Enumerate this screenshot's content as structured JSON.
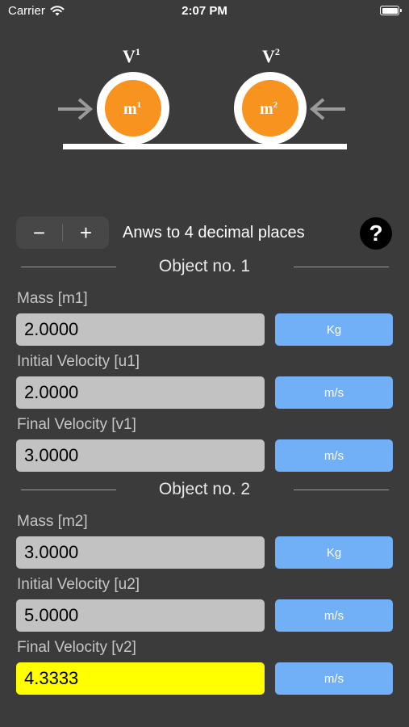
{
  "status_bar": {
    "carrier": "Carrier",
    "time": "2:07 PM"
  },
  "diagram": {
    "velocity_1": "V",
    "velocity_1_sup": "1",
    "velocity_2": "V",
    "velocity_2_sup": "2",
    "mass_1": "m",
    "mass_1_sup": "1",
    "mass_2": "m",
    "mass_2_sup": "2",
    "ball_color": "#f7931e"
  },
  "controls": {
    "minus_label": "−",
    "plus_label": "+",
    "decimals_label": "Anws to 4 decimal places",
    "help_label": "?"
  },
  "object1": {
    "title": "Object no. 1",
    "mass_label": "Mass [m1]",
    "mass_value": "2.0000",
    "mass_unit": "Kg",
    "initial_velocity_label": "Initial Velocity [u1]",
    "initial_velocity_value": "2.0000",
    "initial_velocity_unit": "m/s",
    "final_velocity_label": "Final Velocity [v1]",
    "final_velocity_value": "3.0000",
    "final_velocity_unit": "m/s"
  },
  "object2": {
    "title": "Object no. 2",
    "mass_label": "Mass [m2]",
    "mass_value": "3.0000",
    "mass_unit": "Kg",
    "initial_velocity_label": "Initial Velocity [u2]",
    "initial_velocity_value": "5.0000",
    "initial_velocity_unit": "m/s",
    "final_velocity_label": "Final Velocity [v2]",
    "final_velocity_value": "4.3333",
    "final_velocity_unit": "m/s"
  },
  "colors": {
    "background": "#3b3b3b",
    "field_gray": "#c2c2c2",
    "result_highlight": "#ffff00",
    "unit_button": "#71aff7"
  }
}
